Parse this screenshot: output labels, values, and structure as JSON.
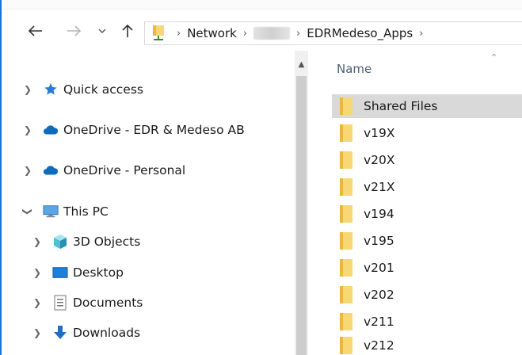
{
  "address": {
    "segments": [
      "Network",
      "EDRMedeso_Apps"
    ]
  },
  "nav_tree": [
    {
      "label": "Quick access",
      "icon": "star-icon",
      "expanded": false
    },
    {
      "label": "OneDrive - EDR & Medeso AB",
      "icon": "cloud-icon",
      "expanded": false
    },
    {
      "label": "OneDrive - Personal",
      "icon": "cloud-icon",
      "expanded": false
    },
    {
      "label": "This PC",
      "icon": "computer-icon",
      "expanded": true
    },
    {
      "label": "3D Objects",
      "icon": "cube-icon",
      "expanded": false
    },
    {
      "label": "Desktop",
      "icon": "desktop-icon",
      "expanded": false
    },
    {
      "label": "Documents",
      "icon": "document-icon",
      "expanded": false
    },
    {
      "label": "Downloads",
      "icon": "download-icon",
      "expanded": false
    }
  ],
  "file_list": {
    "column_name": "Name",
    "items": [
      "Shared Files",
      "v19X",
      "v20X",
      "v21X",
      "v194",
      "v195",
      "v201",
      "v202",
      "v211",
      "v212"
    ],
    "selected": "Shared Files"
  },
  "colors": {
    "accent": "#1e73d2",
    "folder": "#f8d775",
    "selection": "#d9d9d9"
  }
}
